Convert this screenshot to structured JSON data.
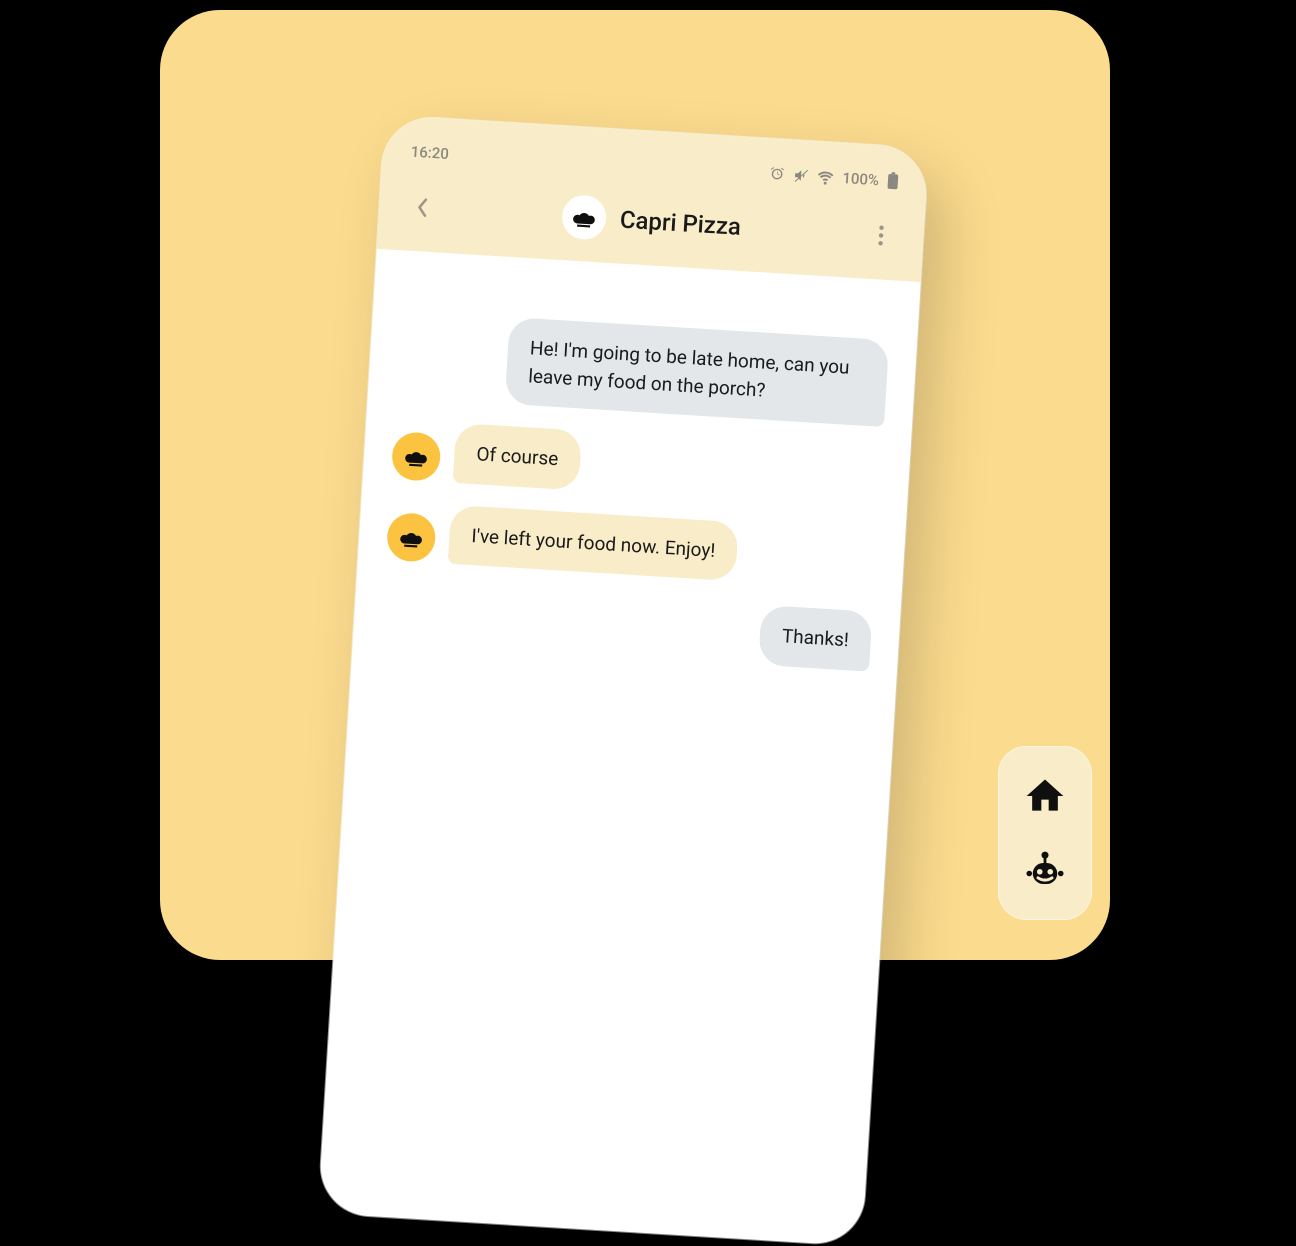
{
  "status_bar": {
    "time": "16:20",
    "battery": "100%",
    "icons": [
      "alarm",
      "mute",
      "wifi",
      "battery"
    ]
  },
  "header": {
    "title": "Capri Pizza",
    "avatar_icon": "chef-hat"
  },
  "messages": [
    {
      "direction": "outgoing",
      "text": "He! I'm going to be late home, can you leave my food on the porch?"
    },
    {
      "direction": "incoming",
      "text": "Of course"
    },
    {
      "direction": "incoming",
      "text": "I've left your food now. Enjoy!"
    },
    {
      "direction": "outgoing",
      "text": "Thanks!"
    }
  ],
  "float_panel": {
    "buttons": [
      "home",
      "bot"
    ]
  },
  "colors": {
    "canvas_bg": "#fbdb8d",
    "header_bg": "#f9ecc8",
    "bubble_incoming": "#f9ecc8",
    "bubble_outgoing": "#e3e7ea",
    "avatar_bg": "#fcc341"
  }
}
